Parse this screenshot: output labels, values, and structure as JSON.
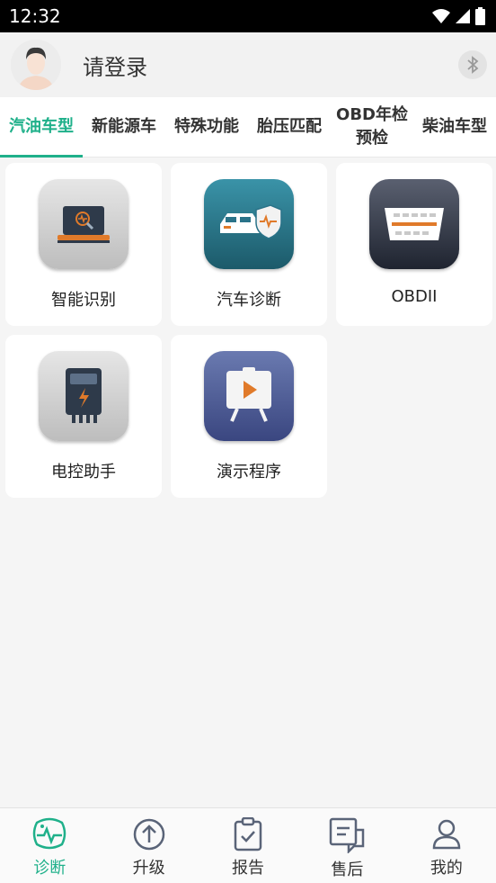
{
  "status_bar": {
    "time": "12:32"
  },
  "header": {
    "login_text": "请登录"
  },
  "tabs": [
    {
      "label": "汽油车型",
      "active": true
    },
    {
      "label": "新能源车"
    },
    {
      "label": "特殊功能"
    },
    {
      "label": "胎压匹配"
    },
    {
      "label": "OBD年检预检"
    },
    {
      "label": "柴油车型"
    }
  ],
  "grid": {
    "items": [
      {
        "label": "智能识别",
        "icon": "laptop-diagnostic-icon"
      },
      {
        "label": "汽车诊断",
        "icon": "car-shield-icon"
      },
      {
        "label": "OBDII",
        "icon": "obd-connector-icon"
      },
      {
        "label": "电控助手",
        "icon": "ecu-assistant-icon"
      },
      {
        "label": "演示程序",
        "icon": "demo-play-icon"
      }
    ]
  },
  "bottom_nav": [
    {
      "label": "诊断",
      "icon": "diagnose-icon",
      "active": true
    },
    {
      "label": "升级",
      "icon": "upgrade-icon"
    },
    {
      "label": "报告",
      "icon": "report-icon"
    },
    {
      "label": "售后",
      "icon": "after-sales-icon"
    },
    {
      "label": "我的",
      "icon": "profile-icon"
    }
  ],
  "colors": {
    "accent": "#1fb08a"
  }
}
